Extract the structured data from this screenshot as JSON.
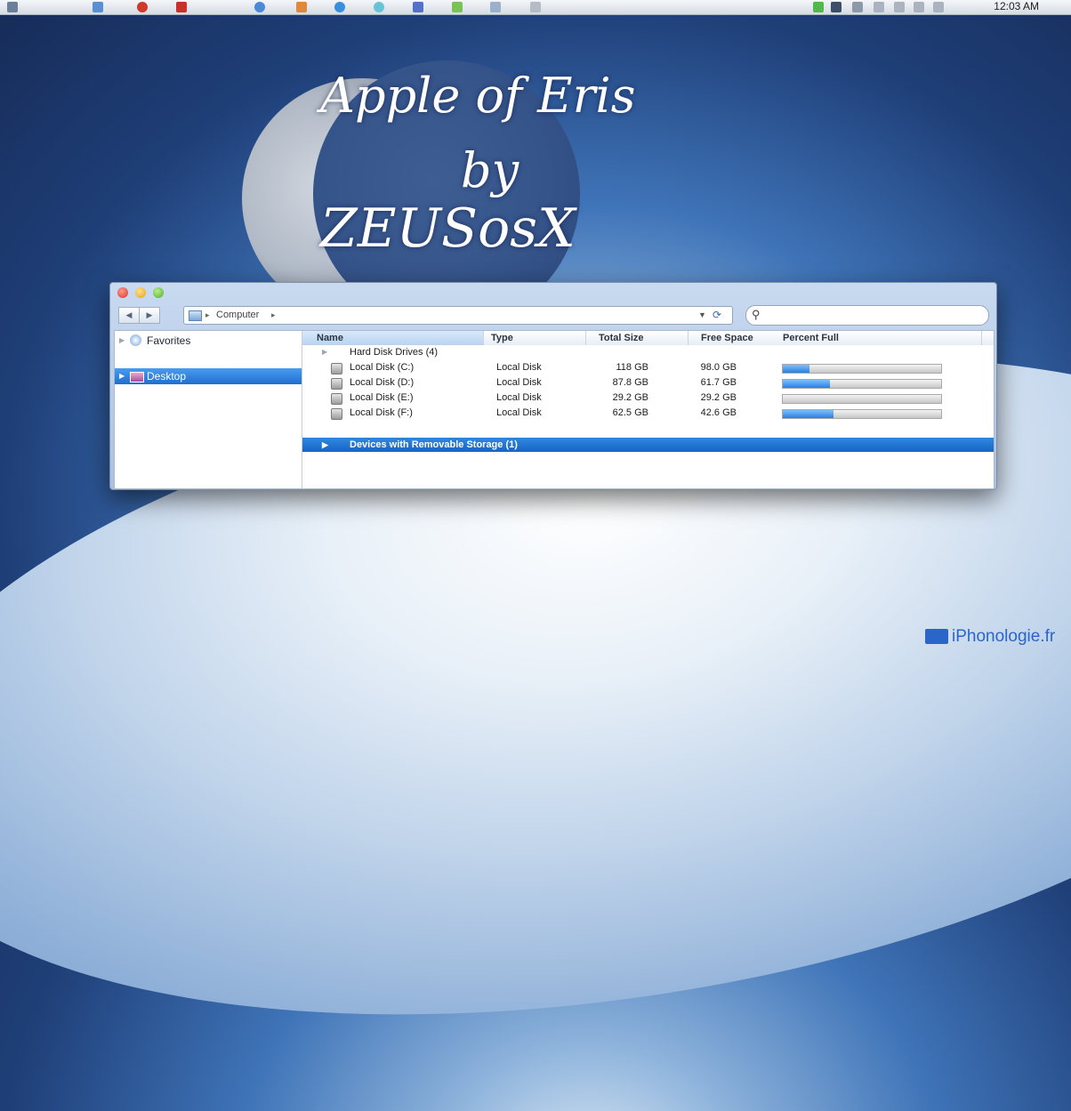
{
  "taskbar": {
    "clock": "12:03 AM"
  },
  "wallpaper_title": {
    "line1": "Apple of Eris",
    "line2": "by",
    "line3": "ZEUSosX"
  },
  "window": {
    "address": {
      "location": "Computer",
      "separator": "▸"
    },
    "search": {
      "placeholder": ""
    },
    "sidebar": [
      {
        "label": "Favorites",
        "selected": false
      },
      {
        "label": "Desktop",
        "selected": true
      }
    ],
    "columns": [
      "Name",
      "Type",
      "Total Size",
      "Free Space",
      "Percent Full"
    ],
    "group_hard_disks": "Hard Disk Drives (4)",
    "disks": [
      {
        "name": "Local Disk (C:)",
        "type": "Local Disk",
        "total": "118 GB",
        "free": "98.0 GB",
        "percent_full": 0.17
      },
      {
        "name": "Local Disk (D:)",
        "type": "Local Disk",
        "total": "87.8 GB",
        "free": "61.7 GB",
        "percent_full": 0.3
      },
      {
        "name": "Local Disk (E:)",
        "type": "Local Disk",
        "total": "29.2 GB",
        "free": "29.2 GB",
        "percent_full": 0.0
      },
      {
        "name": "Local Disk (F:)",
        "type": "Local Disk",
        "total": "62.5 GB",
        "free": "42.6 GB",
        "percent_full": 0.32
      }
    ],
    "group_removable": "Devices with Removable Storage (1)"
  },
  "watermark": "iPhonologie.fr",
  "colors": {
    "selection": "#1765c4",
    "bar_fill": "#2b7fdc"
  }
}
